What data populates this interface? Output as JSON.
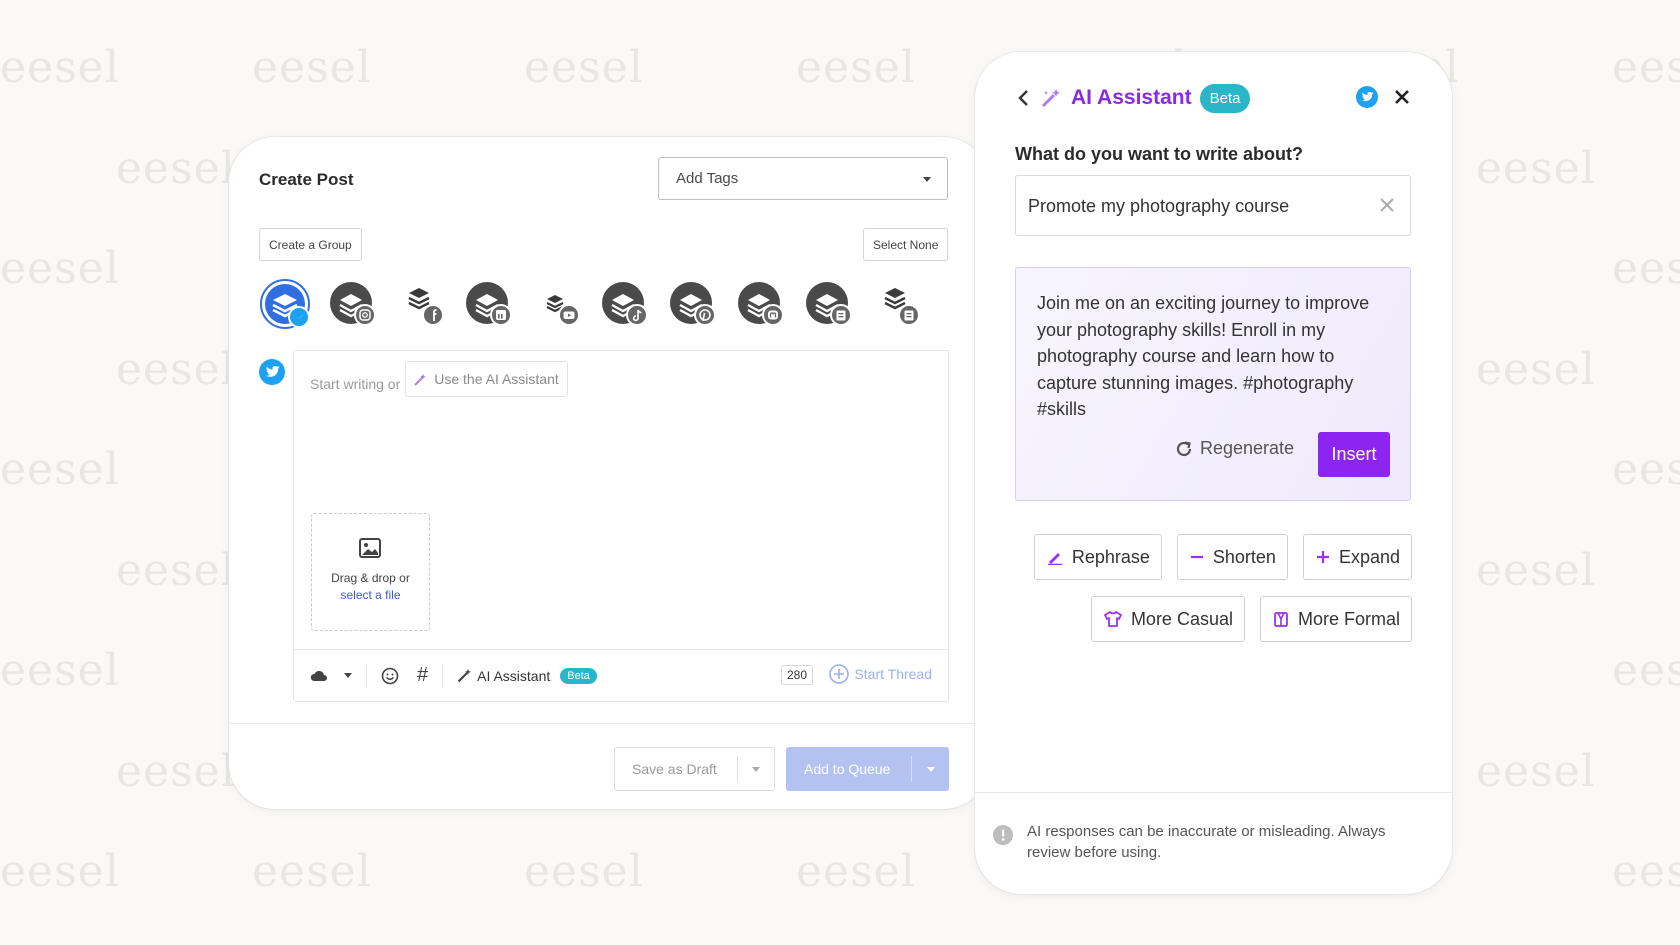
{
  "watermark": {
    "text": "eesel"
  },
  "post": {
    "title": "Create Post",
    "tags_placeholder": "Add Tags",
    "create_group": "Create a Group",
    "select_none": "Select None",
    "channels": [
      {
        "network": "twitter",
        "selected": true
      },
      {
        "network": "instagram"
      },
      {
        "network": "facebook"
      },
      {
        "network": "linkedin"
      },
      {
        "network": "youtube"
      },
      {
        "network": "tiktok"
      },
      {
        "network": "pinterest"
      },
      {
        "network": "mastodon"
      },
      {
        "network": "google-business"
      },
      {
        "network": "google-business"
      }
    ],
    "composer_hint": "Start writing or",
    "use_ai": "Use the AI Assistant",
    "dropzone_text": "Drag & drop or",
    "dropzone_link": "select a file",
    "toolbar": {
      "ai_label": "AI Assistant",
      "beta": "Beta",
      "char_count": "280",
      "start_thread": "Start Thread"
    },
    "save_draft": "Save as Draft",
    "add_queue": "Add to Queue"
  },
  "ai": {
    "title": "AI Assistant",
    "beta": "Beta",
    "question": "What do you want to write about?",
    "input_value": "Promote my photography course",
    "result": "Join me on an exciting journey to improve your photography skills! Enroll in my photography course and learn how to capture stunning images. #photography #skills",
    "regenerate": "Regenerate",
    "insert": "Insert",
    "actions": {
      "rephrase": "Rephrase",
      "shorten": "Shorten",
      "expand": "Expand",
      "more_casual": "More Casual",
      "more_formal": "More Formal"
    },
    "disclaimer": "AI responses can be inaccurate or misleading. Always review before using."
  },
  "colors": {
    "accent_purple": "#8e24f0",
    "twitter_blue": "#1da1f2",
    "beta_teal": "#29b6c9",
    "queue_disabled": "#b4c2f2"
  }
}
